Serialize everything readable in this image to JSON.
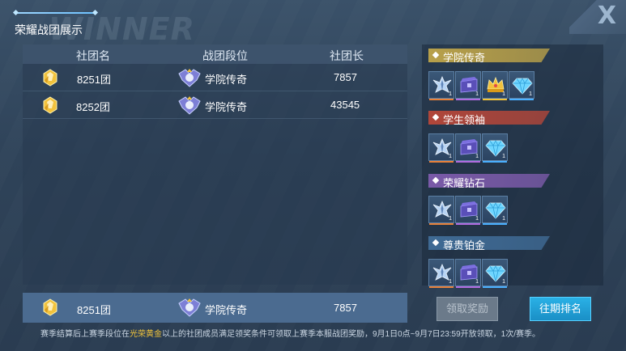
{
  "header": {
    "title": "荣耀战团展示",
    "watermark": "WINNER",
    "close_label": "X"
  },
  "table": {
    "columns": [
      "社团名",
      "战团段位",
      "社团长"
    ],
    "rows": [
      {
        "name": "8251团",
        "rank": "学院传奇",
        "leader": "7857"
      },
      {
        "name": "8252团",
        "rank": "学院传奇",
        "leader": "43545"
      }
    ]
  },
  "my_team": {
    "name": "8251团",
    "rank": "学院传奇",
    "leader": "7857"
  },
  "rewards": {
    "tiers": [
      {
        "label": "学院传奇",
        "color": "#b8a04a",
        "items": [
          {
            "icon": "wings-emblem-icon",
            "qty": "1",
            "bar": "#e8813a"
          },
          {
            "icon": "treasure-chest-icon",
            "qty": "1",
            "bar": "#b06be0"
          },
          {
            "icon": "crown-icon",
            "qty": "1",
            "bar": "#f0c23a"
          },
          {
            "icon": "diamond-icon",
            "qty": "1",
            "bar": "#4ab0ff"
          }
        ]
      },
      {
        "label": "学生领袖",
        "color": "#b0463a",
        "items": [
          {
            "icon": "wings-emblem-icon",
            "qty": "1",
            "bar": "#e8813a"
          },
          {
            "icon": "treasure-chest-icon",
            "qty": "1",
            "bar": "#b06be0"
          },
          {
            "icon": "diamond-icon",
            "qty": "1",
            "bar": "#4ab0ff"
          }
        ]
      },
      {
        "label": "荣耀钻石",
        "color": "#7a5aa8",
        "items": [
          {
            "icon": "wings-emblem-icon",
            "qty": "1",
            "bar": "#e8813a"
          },
          {
            "icon": "treasure-chest-icon",
            "qty": "1",
            "bar": "#b06be0"
          },
          {
            "icon": "diamond-icon",
            "qty": "1",
            "bar": "#4ab0ff"
          }
        ]
      },
      {
        "label": "尊贵铂金",
        "color": "#3f6a94",
        "items": [
          {
            "icon": "wings-emblem-icon",
            "qty": "1",
            "bar": "#e8813a"
          },
          {
            "icon": "treasure-chest-icon",
            "qty": "1",
            "bar": "#b06be0"
          },
          {
            "icon": "diamond-icon",
            "qty": "1",
            "bar": "#4ab0ff"
          }
        ]
      }
    ]
  },
  "buttons": {
    "claim_label": "领取奖励",
    "history_label": "往期排名"
  },
  "footer": {
    "note_before": "赛季结算后上赛季段位在",
    "note_highlight": "光荣黄金",
    "note_after": "以上的社团成员满足领奖条件可领取上赛季本服战团奖励，9月1日0点~9月7日23:59开放领取，1次/赛季。"
  },
  "colors": {
    "accent": "#2ab1e6",
    "highlight": "#f3c53b"
  }
}
